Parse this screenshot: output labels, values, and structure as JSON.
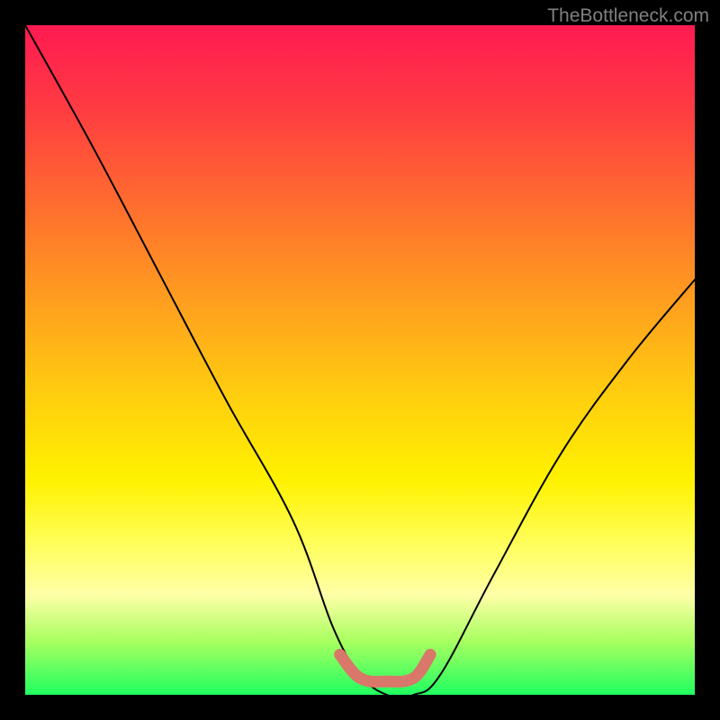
{
  "watermark": "TheBottleneck.com",
  "chart_data": {
    "type": "line",
    "title": "",
    "xlabel": "",
    "ylabel": "",
    "xlim": [
      0,
      100
    ],
    "ylim": [
      0,
      100
    ],
    "series": [
      {
        "name": "bottleneck-curve",
        "x": [
          0,
          10,
          20,
          30,
          40,
          46,
          50,
          54,
          58,
          62,
          70,
          80,
          90,
          100
        ],
        "y": [
          100,
          82,
          63,
          44,
          26,
          10,
          3,
          0,
          0,
          3,
          18,
          36,
          50,
          62
        ]
      }
    ],
    "highlight": {
      "name": "optimal-range",
      "x": [
        47,
        50,
        54,
        58,
        60.5
      ],
      "y": [
        6,
        2.5,
        2,
        2.5,
        6
      ]
    },
    "colors": {
      "curve": "#000000",
      "highlight": "#d9776a"
    }
  }
}
